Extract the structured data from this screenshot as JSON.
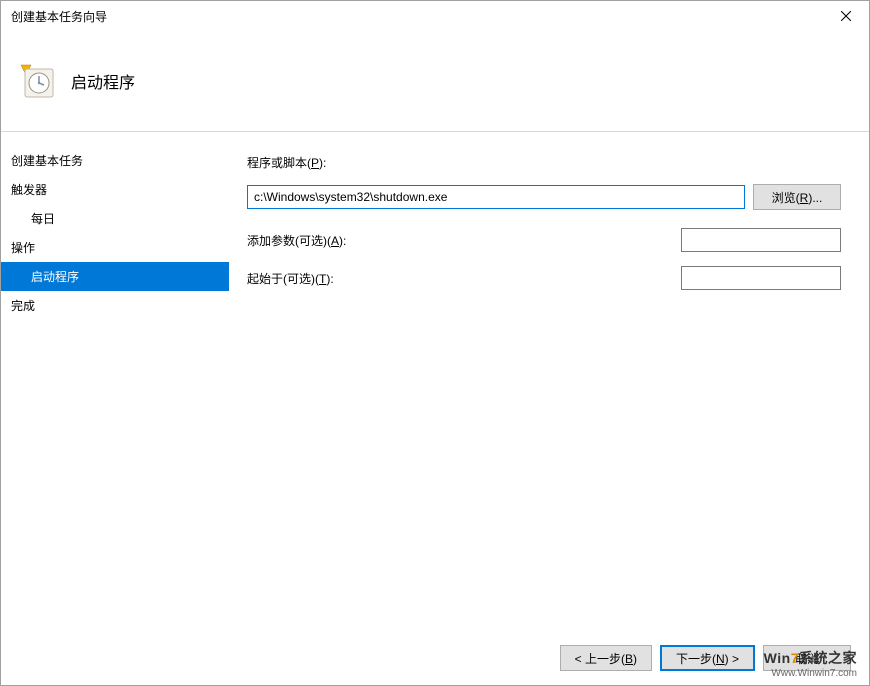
{
  "titlebar": {
    "title": "创建基本任务向导"
  },
  "header": {
    "title": "启动程序"
  },
  "sidebar": {
    "items": [
      {
        "label": "创建基本任务",
        "level": 1
      },
      {
        "label": "触发器",
        "level": 1
      },
      {
        "label": "每日",
        "level": 2
      },
      {
        "label": "操作",
        "level": 1
      },
      {
        "label": "启动程序",
        "level": 2,
        "active": true
      },
      {
        "label": "完成",
        "level": 1
      }
    ]
  },
  "form": {
    "program_label_pre": "程序或脚本(",
    "program_label_key": "P",
    "program_label_post": "):",
    "program_value": "c:\\Windows\\system32\\shutdown.exe",
    "browse_pre": "浏览(",
    "browse_key": "R",
    "browse_post": ")...",
    "args_label_pre": "添加参数(可选)(",
    "args_label_key": "A",
    "args_label_post": "):",
    "args_value": "",
    "startin_label_pre": "起始于(可选)(",
    "startin_label_key": "T",
    "startin_label_post": "):",
    "startin_value": ""
  },
  "footer": {
    "back_pre": "< 上一步(",
    "back_key": "B",
    "back_post": ")",
    "next_pre": "下一步(",
    "next_key": "N",
    "next_post": ") >",
    "cancel": "取消"
  },
  "watermark": {
    "main_a": "Win",
    "main_b": "7",
    "main_c": "系统之家",
    "sub": "Www.Winwin7.com"
  }
}
